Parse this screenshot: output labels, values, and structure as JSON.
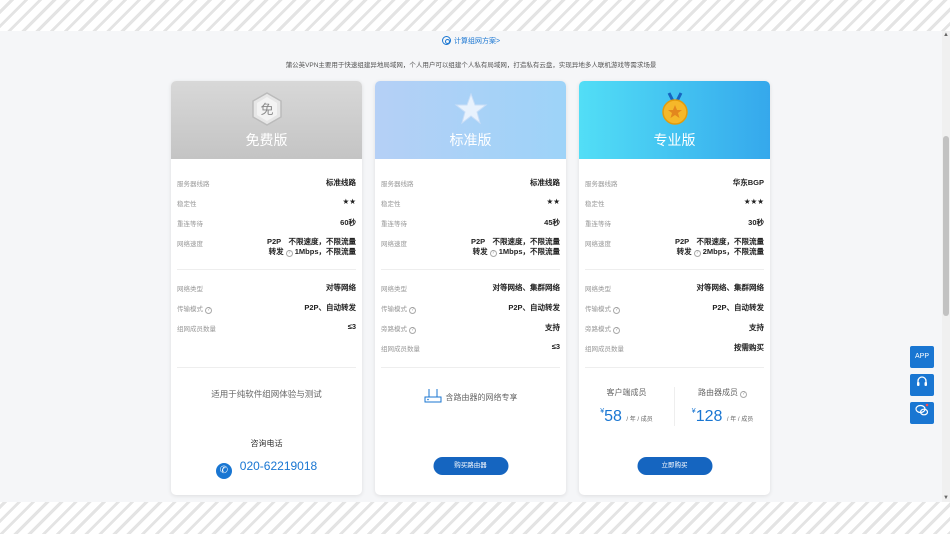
{
  "header": {
    "calc_link": "计算组网方案>",
    "intro": "蒲公英VPN主要用于快速组建异地局域网，个人用户可以组建个人私有局域网，打造私有云盘，实现异地多人联机游戏等需求场景"
  },
  "labels": {
    "server_line": "服务器线路",
    "stability": "稳定性",
    "reconnect_wait": "重连等待",
    "net_speed": "网络速度",
    "net_type": "网络类型",
    "transport_mode": "传输模式",
    "bypass_mode": "旁路模式",
    "member_count": "组网成员数量"
  },
  "plans": [
    {
      "badge_text": "免",
      "title": "免费版",
      "server_line": "标准线路",
      "stars": "★★",
      "reconnect_wait": "60秒",
      "speed_line1": "P2P　不限速度，不限流量",
      "speed_line2_a": "转发",
      "speed_line2_b": "1Mbps，不限流量",
      "net_type": "对等网络",
      "transport_mode": "P2P、自动转发",
      "member_count": "≤3",
      "suit": "适用于纯软件组网体验与测试",
      "consult_label": "咨询电话",
      "phone": "020-62219018"
    },
    {
      "title": "标准版",
      "server_line": "标准线路",
      "stars": "★★",
      "reconnect_wait": "45秒",
      "speed_line1": "P2P　不限速度，不限流量",
      "speed_line2_a": "转发",
      "speed_line2_b": "1Mbps，不限流量",
      "net_type": "对等网络、集群网络",
      "transport_mode": "P2P、自动转发",
      "bypass_mode": "支持",
      "member_count": "≤3",
      "router_text": "含路由器的网络专享",
      "button": "购买路由器"
    },
    {
      "title": "专业版",
      "server_line": "华东BGP",
      "stars": "★★★",
      "reconnect_wait": "30秒",
      "speed_line1": "P2P　不限速度，不限流量",
      "speed_line2_a": "转发",
      "speed_line2_b": "2Mbps，不限流量",
      "net_type": "对等网络、集群网络",
      "transport_mode": "P2P、自动转发",
      "bypass_mode": "支持",
      "member_count": "按需购买",
      "client_label": "客户端成员",
      "router_label": "路由器成员",
      "currency": "¥",
      "client_price": "58",
      "router_price": "128",
      "unit": "/ 年 / 成员",
      "button": "立即购买"
    }
  ],
  "side": {
    "app": "APP"
  },
  "colors": {
    "accent": "#1976d2",
    "button": "#1565c0"
  }
}
